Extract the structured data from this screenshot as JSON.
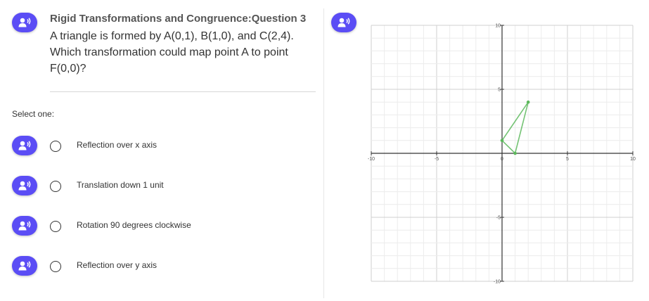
{
  "question": {
    "title": "Rigid Transformations and Congruence:Question 3",
    "text": "A triangle is formed by A(0,1), B(1,0), and C(2,4). Which transformation could map point A to point F(0,0)?"
  },
  "prompt_label": "Select one:",
  "options": [
    {
      "label": "Reflection over x axis",
      "selected": false
    },
    {
      "label": "Translation down 1 unit",
      "selected": false
    },
    {
      "label": "Rotation 90 degrees clockwise",
      "selected": false
    },
    {
      "label": "Reflection over y axis",
      "selected": false
    }
  ],
  "icons": {
    "audio": "speaker-person-icon",
    "audio_button_color": "#5b4df5"
  },
  "chart_data": {
    "type": "scatter",
    "xlim": [
      -10,
      10
    ],
    "ylim": [
      -10,
      10
    ],
    "grid": true,
    "grid_minor_step": 1,
    "grid_major_step": 5,
    "x_ticks": [
      "-10",
      "-5",
      "0",
      "5",
      "10"
    ],
    "y_ticks": [
      "10",
      "5",
      "-5",
      "-10"
    ],
    "triangle": {
      "vertices": [
        {
          "name": "A",
          "x": 0,
          "y": 1
        },
        {
          "name": "B",
          "x": 1,
          "y": 0
        },
        {
          "name": "C",
          "x": 2,
          "y": 4
        }
      ],
      "color": "#5cb85c"
    }
  }
}
